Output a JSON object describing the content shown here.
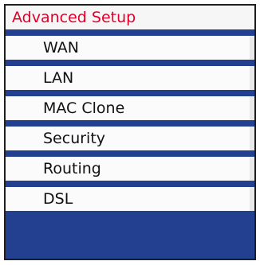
{
  "menu": {
    "title": "Advanced Setup",
    "items": [
      {
        "label": "WAN"
      },
      {
        "label": "LAN"
      },
      {
        "label": "MAC Clone"
      },
      {
        "label": "Security"
      },
      {
        "label": "Routing"
      },
      {
        "label": "DSL"
      }
    ],
    "colors": {
      "title_text": "#e2002a",
      "item_text": "#111111",
      "separator": "#233f8f",
      "background": "#fbfbfb"
    }
  }
}
